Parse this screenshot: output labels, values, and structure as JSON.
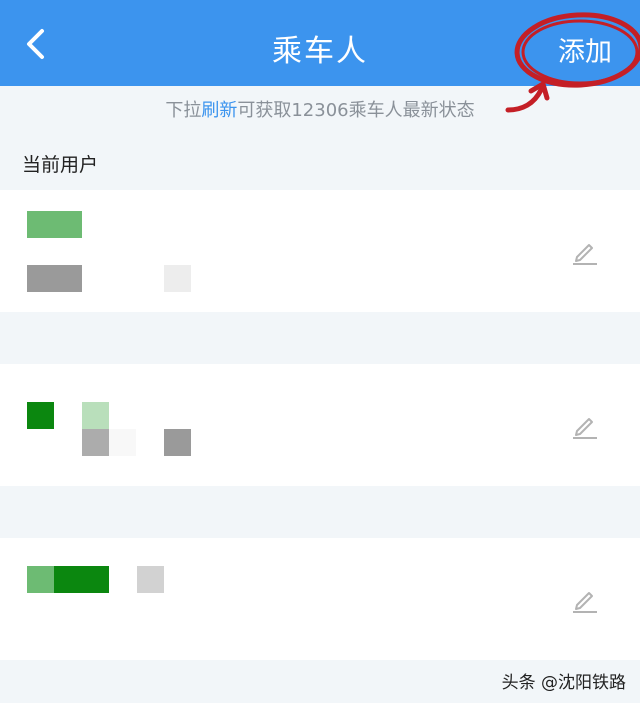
{
  "header": {
    "title": "乘车人",
    "add_label": "添加",
    "back_icon": "chevron-left-icon",
    "background_color": "#3c94ee",
    "annotation_color": "#c41f26"
  },
  "hint": {
    "prefix": "下拉",
    "link": "刷新",
    "suffix": "可获取12306乘车人最新状态"
  },
  "section": {
    "current_user_label": "当前用户"
  },
  "passengers": [
    {
      "edit_icon": "pencil-icon"
    },
    {
      "edit_icon": "pencil-icon"
    },
    {
      "edit_icon": "pencil-icon"
    }
  ],
  "watermark": {
    "text": "头条 @沈阳铁路"
  }
}
